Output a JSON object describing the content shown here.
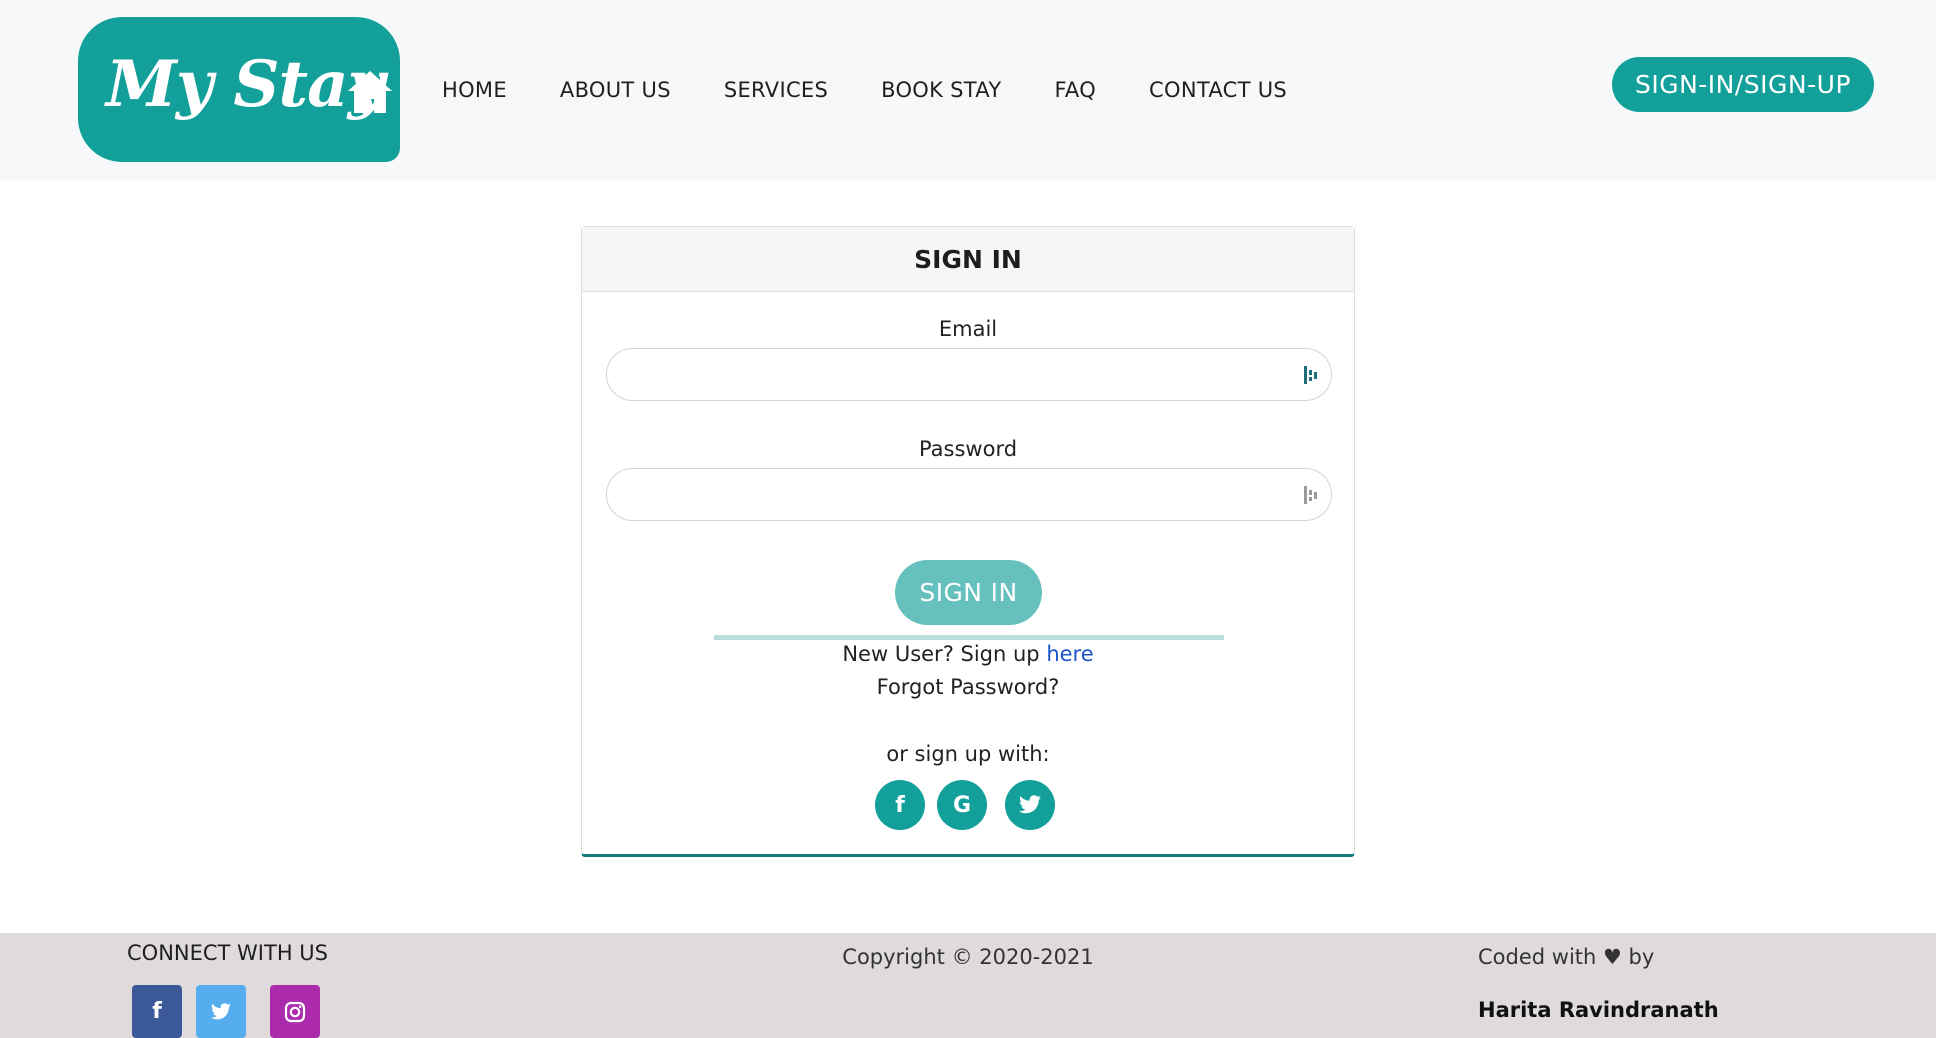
{
  "header": {
    "logo_text": "My Stay",
    "nav": [
      "HOME",
      "ABOUT US",
      "SERVICES",
      "BOOK STAY",
      "FAQ",
      "CONTACT US"
    ],
    "signin_button": "SIGN-IN/SIGN-UP"
  },
  "card": {
    "title": "SIGN IN",
    "email_label": "Email",
    "email_value": "",
    "password_label": "Password",
    "password_value": "",
    "submit_label": "SIGN IN",
    "new_user_text": "New User? Sign up ",
    "here_link": "here",
    "forgot_password": "Forgot Password?",
    "or_signup": "or sign up with:",
    "social": [
      {
        "name": "facebook-icon",
        "glyph": "f"
      },
      {
        "name": "google-icon",
        "glyph": "G"
      },
      {
        "name": "twitter-icon",
        "glyph": "t"
      }
    ]
  },
  "footer": {
    "connect": "CONNECT WITH US",
    "copyright": "Copyright © 2020-2021",
    "coded_with": "Coded with ♥ by",
    "author": "Harita Ravindranath",
    "social": [
      {
        "name": "facebook-icon",
        "glyph": "f",
        "color": "#3b5998"
      },
      {
        "name": "twitter-icon",
        "glyph": "t",
        "color": "#55acee"
      },
      {
        "name": "instagram-icon",
        "glyph": "◎",
        "color": "#ac2bac"
      }
    ]
  },
  "colors": {
    "brand": "#13a09a",
    "button_light": "#66c0bd",
    "link": "#1a56c9",
    "footer_bg": "#dfdadb"
  }
}
